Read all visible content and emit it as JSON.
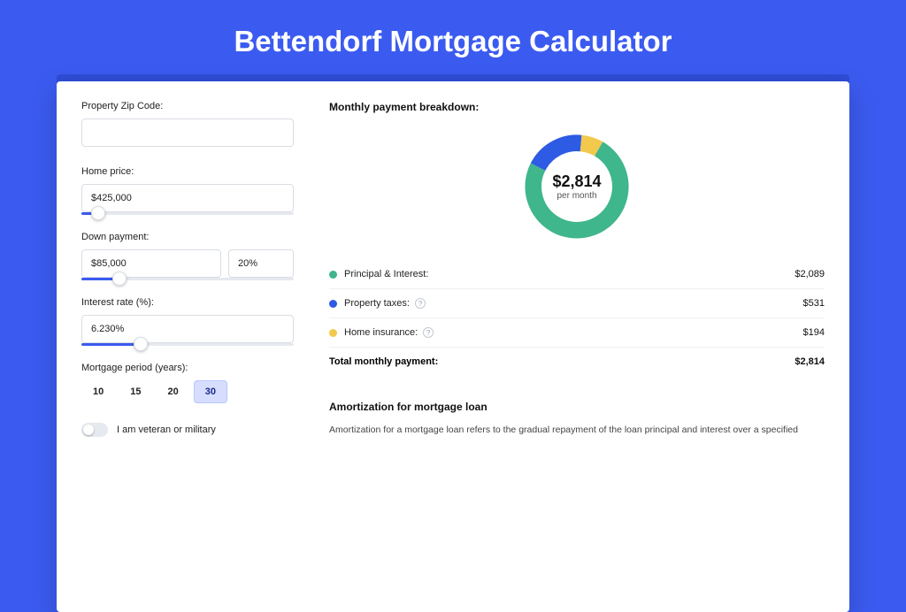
{
  "page": {
    "title": "Bettendorf Mortgage Calculator"
  },
  "form": {
    "zip": {
      "label": "Property Zip Code:",
      "value": ""
    },
    "price": {
      "label": "Home price:",
      "value": "$425,000",
      "slider_pct": 8
    },
    "down": {
      "label": "Down payment:",
      "value": "$85,000",
      "pct": "20%",
      "slider_pct": 18
    },
    "rate": {
      "label": "Interest rate (%):",
      "value": "6.230%",
      "slider_pct": 28
    },
    "period": {
      "label": "Mortgage period (years):",
      "options": [
        "10",
        "15",
        "20",
        "30"
      ],
      "selected": "30"
    },
    "veteran": {
      "label": "I am veteran or military",
      "on": false
    }
  },
  "breakdown": {
    "title": "Monthly payment breakdown:",
    "center_value": "$2,814",
    "center_label": "per month",
    "items": [
      {
        "label": "Principal & Interest:",
        "value": "$2,089",
        "color": "#3fb68b",
        "info": false,
        "share": 74
      },
      {
        "label": "Property taxes:",
        "value": "$531",
        "color": "#2d5be3",
        "info": true,
        "share": 19
      },
      {
        "label": "Home insurance:",
        "value": "$194",
        "color": "#f2c94c",
        "info": true,
        "share": 7
      }
    ],
    "total_label": "Total monthly payment:",
    "total_value": "$2,814"
  },
  "amort": {
    "title": "Amortization for mortgage loan",
    "text": "Amortization for a mortgage loan refers to the gradual repayment of the loan principal and interest over a specified"
  },
  "chart_data": {
    "type": "pie",
    "title": "Monthly payment breakdown",
    "series": [
      {
        "name": "Principal & Interest",
        "value": 2089,
        "color": "#3fb68b"
      },
      {
        "name": "Property taxes",
        "value": 531,
        "color": "#2d5be3"
      },
      {
        "name": "Home insurance",
        "value": 194,
        "color": "#f2c94c"
      }
    ],
    "total": 2814,
    "center_label": "per month"
  }
}
